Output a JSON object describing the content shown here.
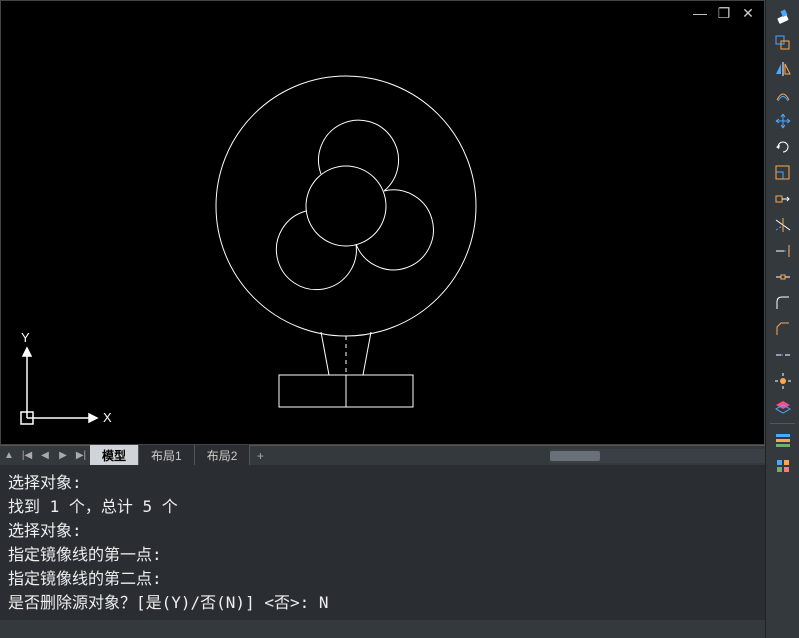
{
  "window": {
    "minimize": "—",
    "maximize": "❐",
    "close": "✕"
  },
  "ucs": {
    "x_label": "X",
    "y_label": "Y"
  },
  "tabs": {
    "model": "模型",
    "layout1": "布局1",
    "layout2": "布局2",
    "add": "+"
  },
  "command_history": [
    "选择对象:",
    "找到 1 个，总计 5 个",
    "选择对象:",
    "指定镜像线的第一点:",
    "指定镜像线的第二点:",
    "是否删除源对象？[是(Y)/否(N)] <否>: N"
  ],
  "tools": {
    "erase": "erase-icon",
    "copy": "copy-icon",
    "mirror": "mirror-icon",
    "offset": "offset-icon",
    "move": "move-icon",
    "rotate": "rotate-icon",
    "scale": "scale-icon",
    "stretch": "stretch-icon",
    "trim": "trim-icon",
    "extend": "extend-icon",
    "fillet": "fillet-icon",
    "chamfer": "chamfer-icon",
    "break": "break-icon",
    "join": "join-icon",
    "explode": "explode-icon",
    "layer": "layer-icon",
    "other1": "tool1-icon",
    "other2": "tool2-icon"
  }
}
